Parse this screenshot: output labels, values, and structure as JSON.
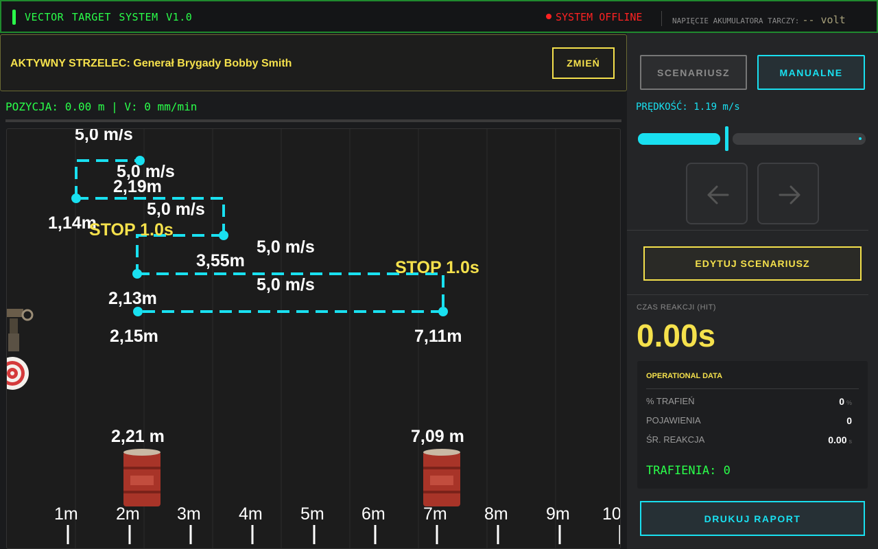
{
  "header": {
    "title": "VECTOR TARGET SYSTEM  V1.0",
    "status": "SYSTEM OFFLINE",
    "battery_label": "NAPIĘCIE AKUMULATORA TARCZY:",
    "battery_value": "-- volt",
    "accent_color": "#2aff4a",
    "status_color": "#ff2222"
  },
  "shooter": {
    "label": "AKTYWNY STRZELEC: Generał Brygady  Bobby Smith",
    "change_button": "ZMIEŃ"
  },
  "position_readout": "POZYCJA: 0.00 m | V: 0 mm/min",
  "range": {
    "axis_ticks": [
      "1m",
      "2m",
      "3m",
      "4m",
      "5m",
      "6m",
      "7m",
      "8m",
      "9m",
      "10"
    ],
    "path_labels": {
      "speed_1": "5,0 m/s",
      "speed_2": "5,0 m/s",
      "dist_1": "2,19m",
      "speed_3": "5,0 m/s",
      "dist_2": "1,14m",
      "stop_1": "STOP 1.0s",
      "speed_4": "5,0 m/s",
      "dist_3": "3,55m",
      "stop_2": "STOP 1.0s",
      "speed_5": "5,0 m/s",
      "dist_4": "2,13m",
      "dist_5": "2,15m",
      "dist_6": "7,11m"
    },
    "barrels": [
      {
        "label": "2,21 m",
        "position_m": 2.21
      },
      {
        "label": "7,09 m",
        "position_m": 7.09
      }
    ],
    "path_color": "#19e0f0"
  },
  "controls": {
    "scenario_button": "SCENARIUSZ",
    "manual_button": "MANUALNE",
    "speed_label": "PRĘDKOŚĆ: 1.19 m/s",
    "speed_fraction": 0.36,
    "left_icon": "arrow-left-icon",
    "right_icon": "arrow-right-icon",
    "edit_button": "EDYTUJ SCENARIUSZ",
    "reaction_label": "CZAS REAKCJI (HIT)",
    "reaction_value": "0.00s"
  },
  "operational": {
    "title": "OPERATIONAL DATA",
    "rows": [
      {
        "label": "% TRAFIEŃ",
        "value": "0",
        "unit": "%"
      },
      {
        "label": "POJAWIENIA",
        "value": "0",
        "unit": ""
      },
      {
        "label": "ŚR. REAKCJA",
        "value": "0.00",
        "unit": "s"
      }
    ],
    "hits": "TRAFIENIA: 0"
  },
  "print_button": "DRUKUJ RAPORT"
}
